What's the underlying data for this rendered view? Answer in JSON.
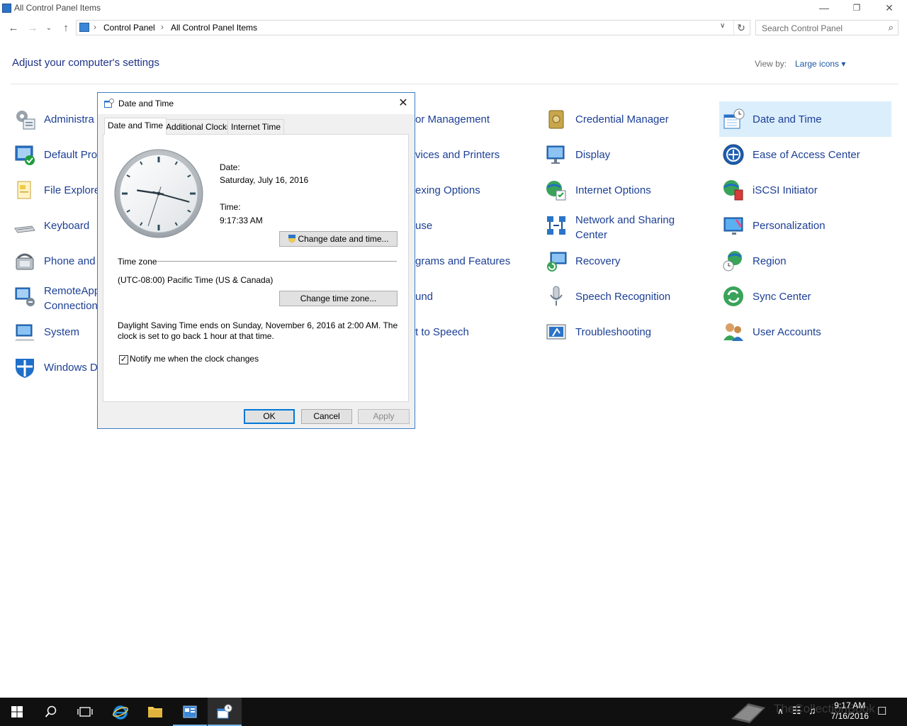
{
  "window": {
    "title": "All Control Panel Items",
    "minimize_glyph": "—",
    "restore_glyph": "❐",
    "close_glyph": "✕"
  },
  "nav": {
    "back": "←",
    "forward": "→",
    "recent": "⌄",
    "up": "↑"
  },
  "address": {
    "crumbs": [
      "Control Panel",
      "All Control Panel Items"
    ],
    "sep": "›",
    "dropdown": "∨",
    "refresh": "↻"
  },
  "search": {
    "placeholder": "Search Control Panel",
    "icon": "⌕"
  },
  "header": {
    "title": "Adjust your computer's settings",
    "view_by_label": "View by:",
    "view_by_value": "Large icons ▾"
  },
  "items": {
    "col1": [
      "Administra",
      "Default Pro",
      "File Explore",
      "Keyboard",
      "Phone and",
      "RemoteApp",
      "Connection",
      "System",
      "Windows D"
    ],
    "col2": [
      "or Management",
      "vices and Printers",
      "exing Options",
      "use",
      "grams and Features",
      "und",
      "t to Speech"
    ],
    "col3": [
      "Credential Manager",
      "Display",
      "Internet Options",
      "Network and Sharing",
      "Center",
      "Recovery",
      "Speech Recognition",
      "Troubleshooting"
    ],
    "col4": [
      "Date and Time",
      "Ease of Access Center",
      "iSCSI Initiator",
      "Personalization",
      "Region",
      "Sync Center",
      "User Accounts"
    ]
  },
  "dialog": {
    "title": "Date and Time",
    "close": "✕",
    "tabs": [
      "Date and Time",
      "Additional Clocks",
      "Internet Time"
    ],
    "date_label": "Date:",
    "date_value": "Saturday, July 16, 2016",
    "time_label": "Time:",
    "time_value": "9:17:33 AM",
    "change_datetime_button": "Change date and time...",
    "timezone_heading": "Time zone",
    "timezone_value": "(UTC-08:00) Pacific Time (US & Canada)",
    "change_timezone_button": "Change time zone...",
    "dst_line1": "Daylight Saving Time ends on Sunday, November 6, 2016 at 2:00 AM. The",
    "dst_line2": "clock is set to go back 1 hour at that time.",
    "notify_label": "Notify me when the clock changes",
    "notify_checked": true,
    "check_glyph": "✓",
    "ok": "OK",
    "cancel": "Cancel",
    "apply": "Apply",
    "clock": {
      "hour": 9,
      "minute": 17,
      "second": 33
    }
  },
  "taskbar": {
    "time": "9:17 AM",
    "date": "7/16/2016",
    "watermark": "TheCollectionBook",
    "tray": [
      "∧",
      "☷",
      "♫",
      "☐"
    ]
  },
  "colors": {
    "link": "#1c3f95",
    "heading": "#1e3287",
    "selection": "#dbeefc",
    "accent": "#0078d7"
  }
}
